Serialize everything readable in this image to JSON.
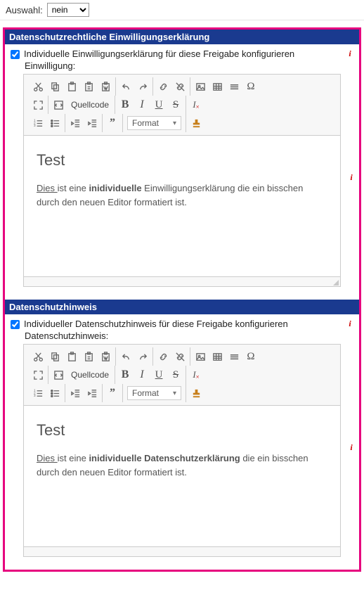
{
  "top": {
    "auswahl_label": "Auswahl:",
    "auswahl_value": "nein"
  },
  "section1": {
    "header": "Datenschutzrechtliche Einwilligungserklärung",
    "checkbox_label": "Individuelle Einwilligungserklärung für diese Freigabe konfigurieren",
    "sub_label": "Einwilligung:",
    "editor": {
      "source_label": "Quellcode",
      "format_label": "Format",
      "heading": "Test",
      "body_pre_u": "Dies ",
      "body_mid1": "ist eine ",
      "body_bold": "inidividuelle",
      "body_mid2": " Einwilligungserklärung die ein bisschen durch den neuen Editor formatiert ist."
    }
  },
  "section2": {
    "header": "Datenschutzhinweis",
    "checkbox_label": "Individueller Datenschutzhinweis für diese Freigabe konfigurieren",
    "sub_label": "Datenschutzhinweis:",
    "editor": {
      "source_label": "Quellcode",
      "format_label": "Format",
      "heading": "Test",
      "body_pre_u": "Dies ",
      "body_mid1": "ist eine ",
      "body_bold": "inidividuelle Datenschutzerklärung",
      "body_mid2": " die ein bisschen durch den neuen Editor formatiert ist."
    }
  },
  "icons": {
    "cut": "cut-icon",
    "copy": "copy-icon",
    "paste": "paste-icon",
    "paste_text": "paste-text-icon",
    "paste_word": "paste-word-icon",
    "undo": "undo-icon",
    "redo": "redo-icon",
    "link": "link-icon",
    "unlink": "unlink-icon",
    "image": "image-icon",
    "table": "table-icon",
    "hr": "hr-icon",
    "omega": "omega-icon",
    "maximize": "maximize-icon",
    "source": "source-icon",
    "bold": "B",
    "italic": "I",
    "underline": "U",
    "strike": "S",
    "clearfmt": "I",
    "ol": "ol-icon",
    "ul": "ul-icon",
    "outdent": "outdent-icon",
    "indent": "indent-icon",
    "quote": "”",
    "stamp": "stamp-icon"
  }
}
